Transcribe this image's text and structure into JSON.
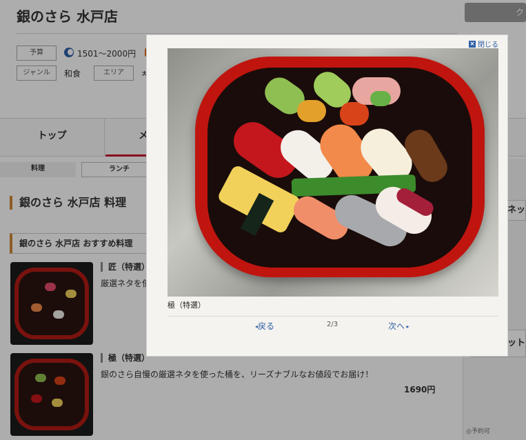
{
  "page": {
    "shop_title": "銀のさら 水戸店",
    "top_button_label": "ク",
    "info": {
      "budget_label": "予算",
      "budget_value": "1501～2000円",
      "genre_label": "ジャンル",
      "genre_value": "和食",
      "area_label": "エリア",
      "area_value_fragment": "ㅊ"
    },
    "tabs": {
      "top_label": "トップ",
      "menu_fragment": "メ",
      "right_fragment": ")"
    },
    "subtabs": {
      "food_label": "料理",
      "lunch_label": "ランチ"
    },
    "section_heading": "銀のさら 水戸店 料理",
    "recommend_heading": "銀のさら 水戸店 おすすめ料理",
    "items": [
      {
        "name": "匠（特選）",
        "desc_fragment": "厳選ネタを使"
      },
      {
        "name": "極（特選）",
        "desc": "銀のさら自慢の厳選ネタを使った桶を、リーズナブルなお値段でお届け！",
        "price": "1690円"
      }
    ],
    "right_column": {
      "bar1_fragment": "ネッ",
      "bar2_fragment": "ット",
      "bottom_fragment": "◎予約可"
    }
  },
  "lightbox": {
    "close_label": "閉じる",
    "close_icon": "close-icon",
    "photo_alt": "極（特選）",
    "caption": "極（特選）",
    "prev_label": "戻る",
    "counter": "2/3",
    "next_label": "次へ"
  },
  "colors": {
    "accent_red": "#c8102e",
    "link_blue": "#2e5fa6",
    "heading_bar": "#d08a3a"
  }
}
